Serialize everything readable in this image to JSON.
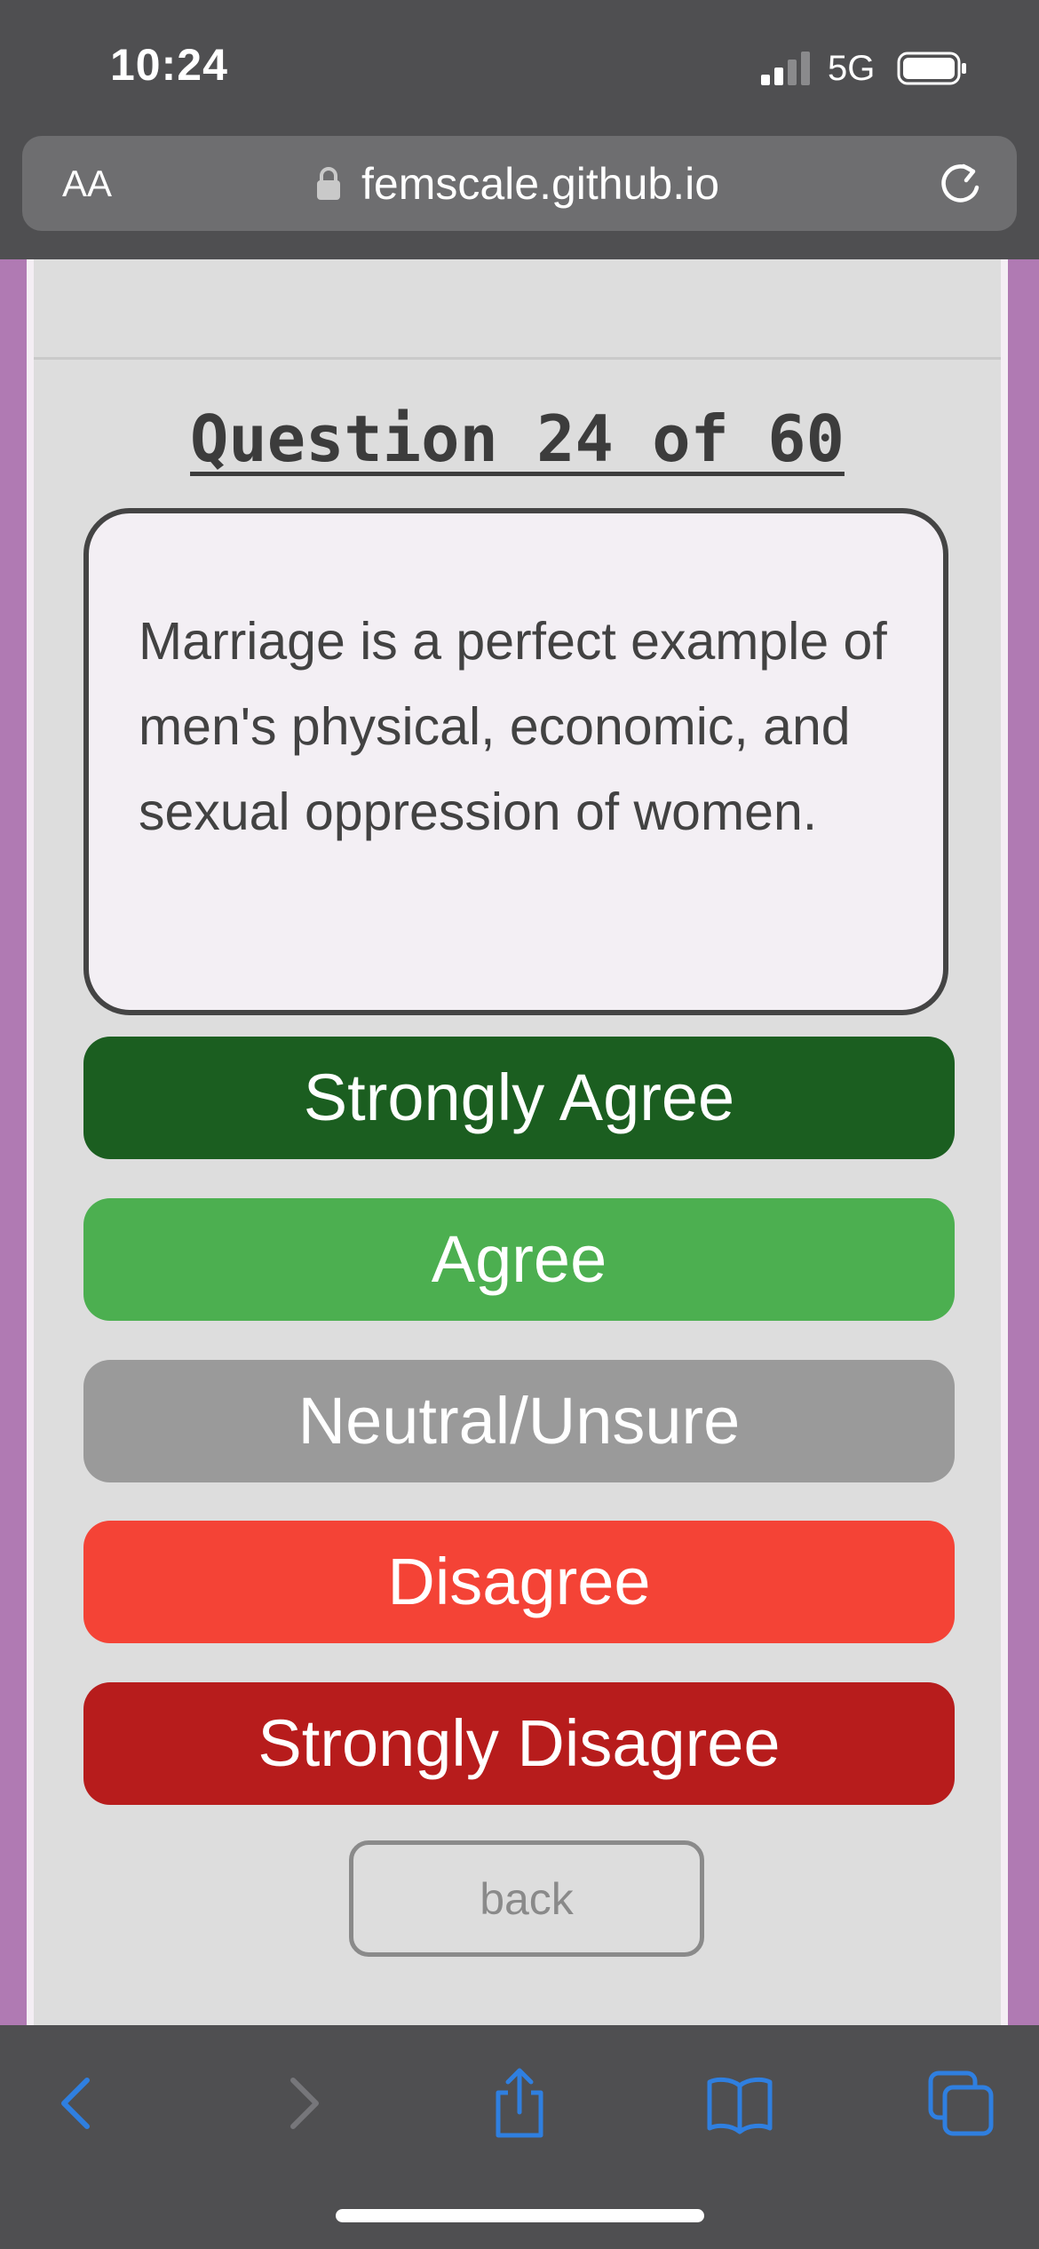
{
  "status_bar": {
    "time": "10:24",
    "network": "5G"
  },
  "browser": {
    "text_size_label": "AA",
    "url": "femscale.github.io"
  },
  "quiz": {
    "question_title": "Question 24 of 60",
    "question_text": "Marriage is a perfect example of men's physical, economic, and sexual oppression of women.",
    "answers": [
      "Strongly Agree",
      "Agree",
      "Neutral/Unsure",
      "Disagree",
      "Strongly Disagree"
    ],
    "back_label": "back"
  },
  "toolbar": {
    "icons": [
      "back-icon",
      "forward-icon",
      "share-icon",
      "bookmarks-icon",
      "tabs-icon"
    ]
  },
  "colors": {
    "page_background": "#b07ab3",
    "panel_background": "#dddddd",
    "strongly_agree": "#1b5e20",
    "agree": "#4caf50",
    "neutral": "#9a9a9a",
    "disagree": "#f44336",
    "strongly_disagree": "#b71c1c",
    "toolbar_accent": "#2f7fe0"
  }
}
